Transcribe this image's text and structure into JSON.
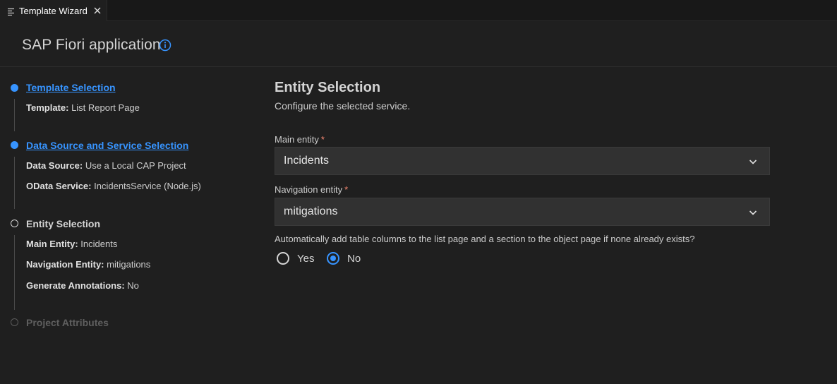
{
  "tab": {
    "title": "Template Wizard"
  },
  "header": {
    "title": "SAP Fiori application"
  },
  "steps": [
    {
      "title": "Template Selection",
      "status": "done",
      "details": [
        {
          "key": "Template:",
          "value": "List Report Page"
        }
      ]
    },
    {
      "title": "Data Source and Service Selection",
      "status": "done",
      "details": [
        {
          "key": "Data Source:",
          "value": "Use a Local CAP Project"
        },
        {
          "key": "OData Service:",
          "value": "IncidentsService (Node.js)"
        }
      ]
    },
    {
      "title": "Entity Selection",
      "status": "current",
      "details": [
        {
          "key": "Main Entity:",
          "value": "Incidents"
        },
        {
          "key": "Navigation Entity:",
          "value": "mitigations"
        },
        {
          "key": "Generate Annotations:",
          "value": "No"
        }
      ]
    },
    {
      "title": "Project Attributes",
      "status": "future",
      "details": []
    }
  ],
  "form": {
    "title": "Entity Selection",
    "subtitle": "Configure the selected service.",
    "main_entity": {
      "label": "Main entity",
      "required": "*",
      "value": "Incidents"
    },
    "navigation_entity": {
      "label": "Navigation entity",
      "required": "*",
      "value": "mitigations"
    },
    "question": "Automatically add table columns to the list page and a section to the object page if none already exists?",
    "options": [
      {
        "label": "Yes",
        "checked": false
      },
      {
        "label": "No",
        "checked": true
      }
    ]
  },
  "colors": {
    "accent": "#3794ff",
    "background": "#1f1f1f",
    "required": "#f48771"
  }
}
